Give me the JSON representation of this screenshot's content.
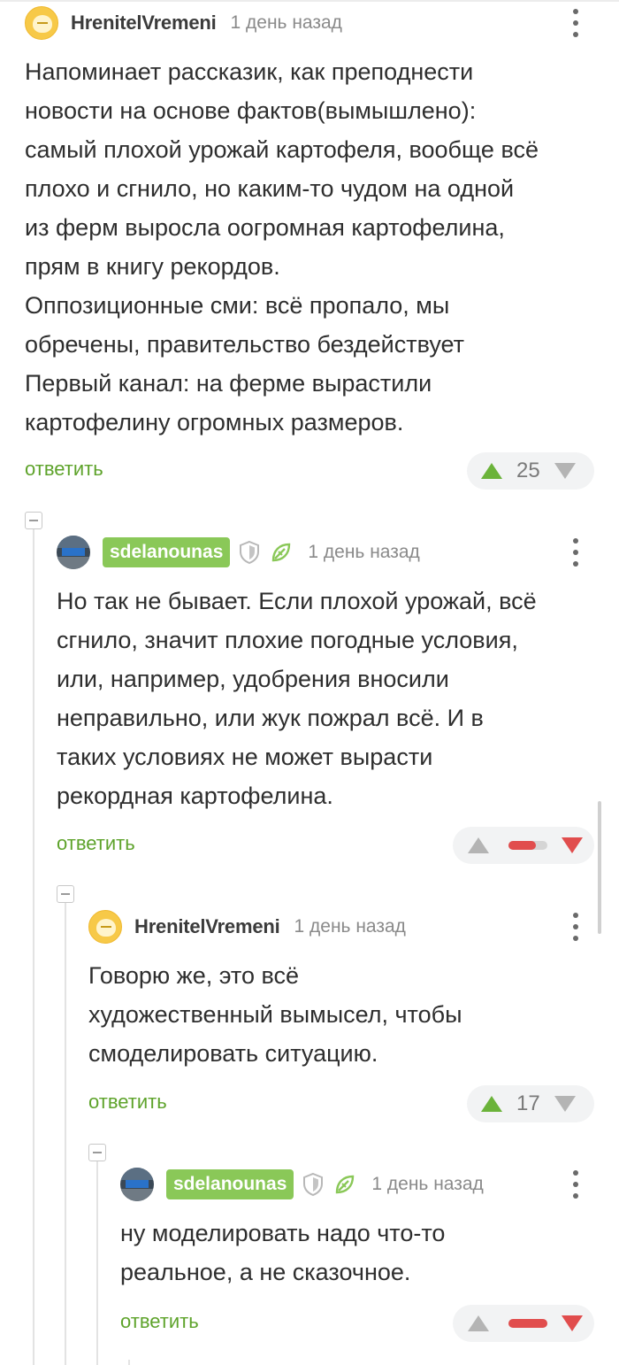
{
  "comments": [
    {
      "author": "HrenitelVremeni",
      "time": "1 день назад",
      "text": [
        "Напоминает рассказик, как преподнести",
        "новости на основе фактов(вымышлено):",
        "самый плохой урожай картофеля, вообще всё",
        "плохо и сгнило, но каким-то чудом на одной",
        "из ферм выросла оогромная картофелина,",
        "прям в книгу рекордов.",
        "Оппозиционные сми: всё пропало, мы",
        "обречены, правительство бездействует",
        "Первый канал: на ферме вырастили",
        "картофелину огромных размеров."
      ],
      "reply_label": "ответить",
      "rating": "25"
    },
    {
      "author": "sdelanounas",
      "time": "1 день назад",
      "text": [
        "Но так не бывает. Если плохой урожай, всё",
        "сгнило, значит плохие погодные условия,",
        "или, например, удобрения вносили",
        "неправильно, или жук пожрал всё. И в",
        "таких условиях не может вырасти",
        "рекордная картофелина."
      ],
      "reply_label": "ответить",
      "rating_bar_fraction": 0.7
    },
    {
      "author": "HrenitelVremeni",
      "time": "1 день назад",
      "text": [
        "Говорю же, это всё",
        "художественный вымысел, чтобы",
        "смоделировать ситуацию."
      ],
      "reply_label": "ответить",
      "rating": "17"
    },
    {
      "author": "sdelanounas",
      "time": "1 день назад",
      "text": [
        "ну моделировать надо что-то",
        "реальное, а не сказочное."
      ],
      "reply_label": "ответить",
      "rating_bar_fraction": 1.0
    }
  ],
  "colors": {
    "accent_green": "#6bb33a",
    "reply_green": "#5ea32b",
    "minus_red": "#e14d4d",
    "badge_green": "#8ac858"
  },
  "icons": {
    "vote_up": "triangle-up-icon",
    "vote_down": "triangle-down-icon",
    "menu": "more-vertical-icon",
    "shield": "shield-icon",
    "leaf": "leaf-icon",
    "collapse": "collapse-minus-icon"
  }
}
